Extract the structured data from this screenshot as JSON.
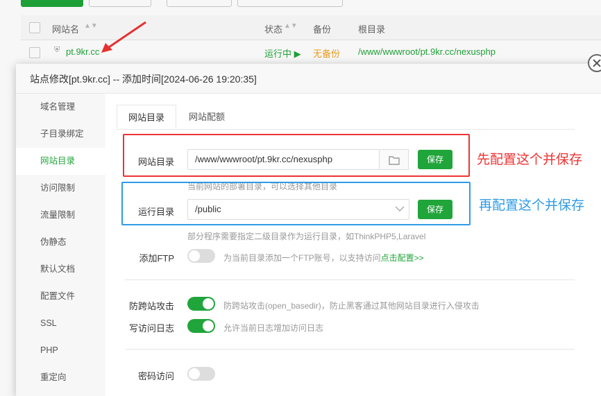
{
  "table": {
    "columns": {
      "name": "网站名",
      "status": "状态",
      "backup": "备份",
      "root": "根目录"
    },
    "row": {
      "name": "pt.9kr.cc",
      "status": "运行中 ▶",
      "backup": "无备份",
      "root": "/www/wwwroot/pt.9kr.cc/nexusphp"
    }
  },
  "modal": {
    "title": "站点修改[pt.9kr.cc] -- 添加时间[2024-06-26 19:20:35]",
    "sidebar": [
      {
        "label": "域名管理"
      },
      {
        "label": "子目录绑定"
      },
      {
        "label": "网站目录"
      },
      {
        "label": "访问限制"
      },
      {
        "label": "流量限制"
      },
      {
        "label": "伪静态"
      },
      {
        "label": "默认文档"
      },
      {
        "label": "配置文件"
      },
      {
        "label": "SSL"
      },
      {
        "label": "PHP"
      },
      {
        "label": "重定向"
      }
    ],
    "tabs": [
      {
        "label": "网站目录"
      },
      {
        "label": "网站配额"
      }
    ],
    "site_dir": {
      "label": "网站目录",
      "value": "/www/wwwroot/pt.9kr.cc/nexusphp",
      "save": "保存",
      "hint": "当前网站的部署目录，可以选择其他目录"
    },
    "run_dir": {
      "label": "运行目录",
      "value": "/public",
      "save": "保存",
      "hint": "部分程序需要指定二级目录作为运行目录，如ThinkPHP5,Laravel"
    },
    "ftp": {
      "label": "添加FTP",
      "hint": "为当前目录添加一个FTP账号，以支持访问",
      "link": "点击配置>>",
      "enabled": false
    },
    "cross_site": {
      "label": "防跨站攻击",
      "hint": "防跨站攻击(open_basedir)，防止黑客通过其他网站目录进行入侵攻击",
      "enabled": true
    },
    "access_log": {
      "label": "写访问日志",
      "hint": "允许当前日志增加访问日志",
      "enabled": true
    },
    "password": {
      "label": "密码访问",
      "enabled": false
    }
  },
  "annotations": {
    "red": "先配置这个并保存",
    "blue": "再配置这个并保存"
  },
  "colors": {
    "accent": "#20a53a",
    "red": "#e33333",
    "blue": "#2e9be8"
  }
}
